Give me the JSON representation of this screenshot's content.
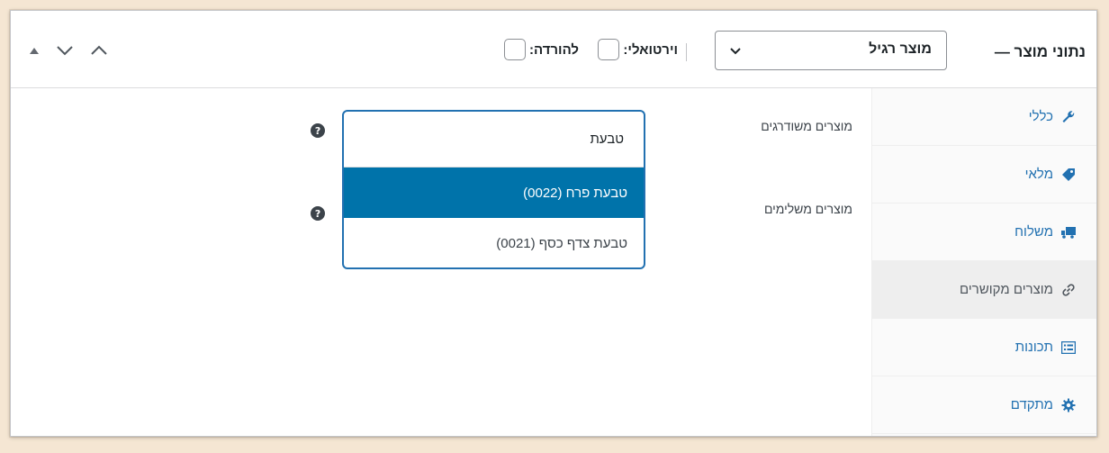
{
  "header": {
    "title": "נתוני מוצר —",
    "product_type": "מוצר רגיל",
    "virtual_label": "וירטואלי:",
    "download_label": "להורדה:"
  },
  "tabs": [
    {
      "label": "כללי",
      "icon": "wrench-icon"
    },
    {
      "label": "מלאי",
      "icon": "tag-icon"
    },
    {
      "label": "משלוח",
      "icon": "truck-icon"
    },
    {
      "label": "מוצרים מקושרים",
      "icon": "link-icon",
      "active": true
    },
    {
      "label": "תכונות",
      "icon": "list-icon"
    },
    {
      "label": "מתקדם",
      "icon": "gear-icon"
    }
  ],
  "form": {
    "upsells_label": "מוצרים משודרגים",
    "crosssells_label": "מוצרים משלימים",
    "help_glyph": "?",
    "search_value": "טבעת",
    "options": [
      {
        "label": "טבעת פרח (0022)",
        "highlighted": true
      },
      {
        "label": "טבעת צדף כסף (0021)",
        "highlighted": false
      }
    ]
  },
  "colors": {
    "accent": "#2271b1",
    "highlight": "#0073aa"
  }
}
